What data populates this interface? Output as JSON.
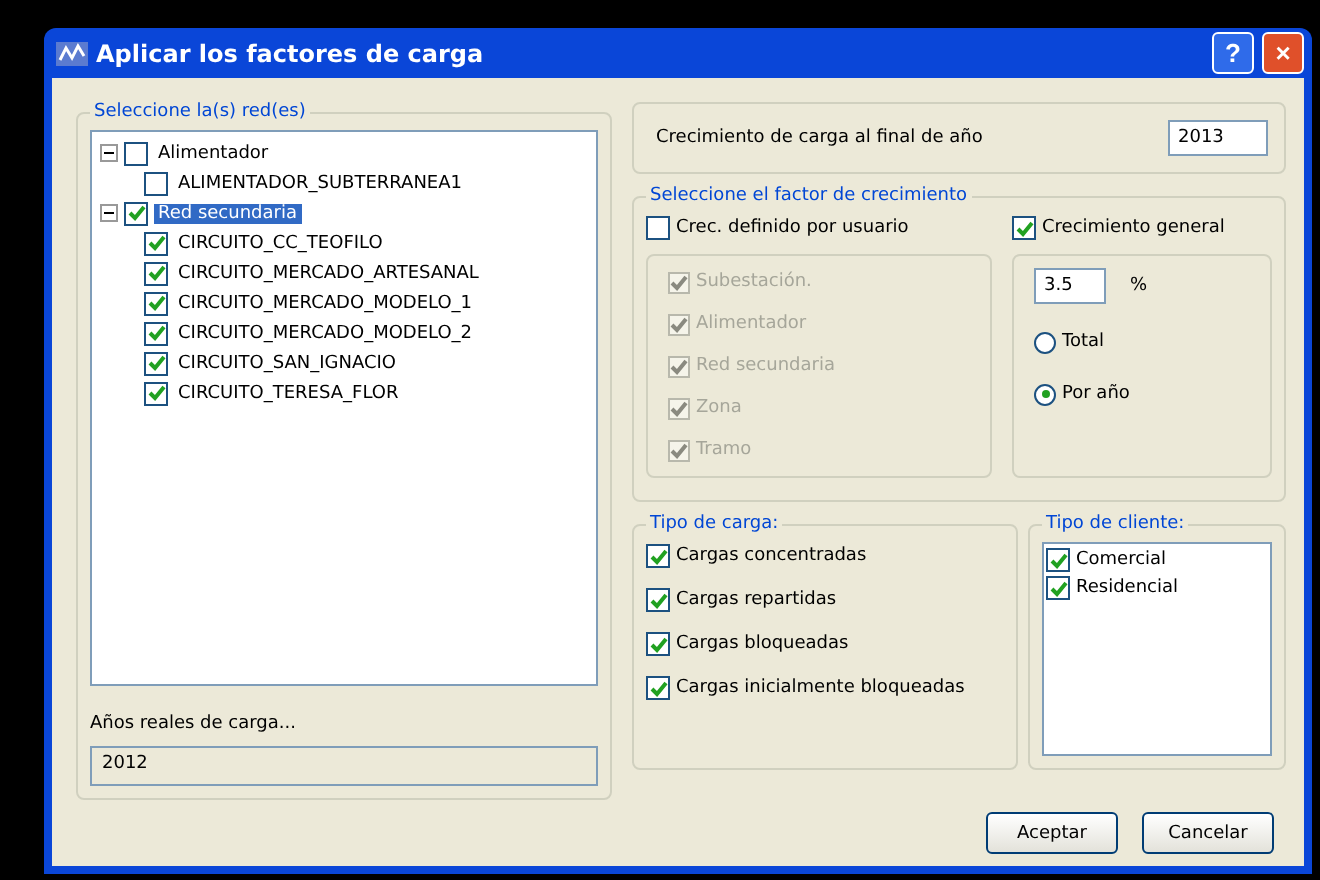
{
  "window": {
    "title": "Aplicar los factores de carga",
    "buttons": [
      "?",
      "×"
    ]
  },
  "networks": {
    "legend": "Seleccione la(s) red(es)",
    "tree": [
      {
        "label": "Alimentador",
        "checked": false,
        "selected": false,
        "expanded": true,
        "children": [
          {
            "label": "ALIMENTADOR_SUBTERRANEA1",
            "checked": false
          }
        ]
      },
      {
        "label": "Red secundaria",
        "checked": true,
        "selected": true,
        "expanded": true,
        "children": [
          {
            "label": "CIRCUITO_CC_TEOFILO",
            "checked": true
          },
          {
            "label": "CIRCUITO_MERCADO_ARTESANAL",
            "checked": true
          },
          {
            "label": "CIRCUITO_MERCADO_MODELO_1",
            "checked": true
          },
          {
            "label": "CIRCUITO_MERCADO_MODELO_2",
            "checked": true
          },
          {
            "label": "CIRCUITO_SAN_IGNACIO",
            "checked": true
          },
          {
            "label": "CIRCUITO_TERESA_FLOR",
            "checked": true
          }
        ]
      }
    ],
    "years_label": "Años reales de carga...",
    "years_value": "2012"
  },
  "growth_year": {
    "label": "Crecimiento de carga al final de año",
    "value": "2013"
  },
  "growth_factor": {
    "legend": "Seleccione el factor de crecimiento",
    "user_defined": {
      "label": "Crec. definido por usuario",
      "checked": false
    },
    "user_options": [
      {
        "label": "Subestación.",
        "checked": true,
        "disabled": true
      },
      {
        "label": "Alimentador",
        "checked": true,
        "disabled": true
      },
      {
        "label": "Red secundaria",
        "checked": true,
        "disabled": true
      },
      {
        "label": "Zona",
        "checked": true,
        "disabled": true
      },
      {
        "label": "Tramo",
        "checked": true,
        "disabled": true
      }
    ],
    "general": {
      "label": "Crecimiento general",
      "checked": true
    },
    "percent_value": "3.5",
    "percent_unit": "%",
    "modes": [
      {
        "label": "Total",
        "selected": false
      },
      {
        "label": "Por año",
        "selected": true
      }
    ]
  },
  "load_type": {
    "legend": "Tipo de carga:",
    "items": [
      {
        "label": "Cargas concentradas",
        "checked": true
      },
      {
        "label": "Cargas repartidas",
        "checked": true
      },
      {
        "label": "Cargas bloqueadas",
        "checked": true
      },
      {
        "label": "Cargas inicialmente bloqueadas",
        "checked": true
      }
    ]
  },
  "client_type": {
    "legend": "Tipo de cliente:",
    "items": [
      {
        "label": "Comercial",
        "checked": true
      },
      {
        "label": "Residencial",
        "checked": true
      }
    ]
  },
  "buttons": [
    "Aceptar",
    "Cancelar"
  ]
}
